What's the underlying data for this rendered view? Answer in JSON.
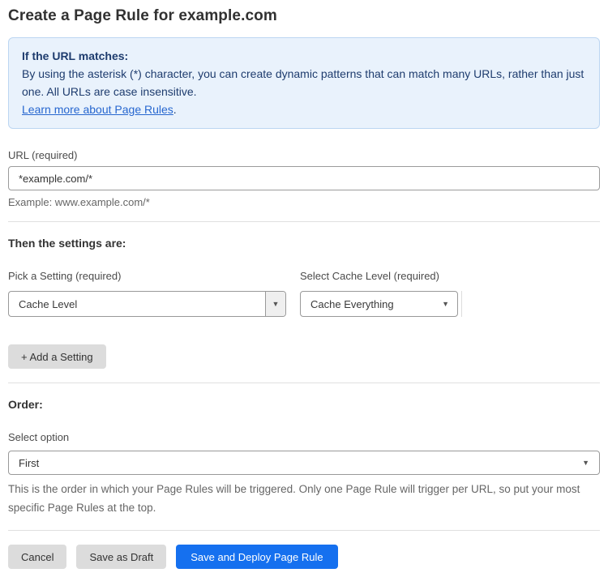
{
  "page": {
    "title": "Create a Page Rule for example.com"
  },
  "info_box": {
    "heading": "If the URL matches:",
    "body": "By using the asterisk (*) character, you can create dynamic patterns that can match many URLs, rather than just one. All URLs are case insensitive.",
    "link": "Learn more about Page Rules",
    "link_suffix": "."
  },
  "url_field": {
    "label": "URL (required)",
    "value": "*example.com/*",
    "helper": "Example: www.example.com/*"
  },
  "settings": {
    "heading": "Then the settings are:",
    "setting_label": "Pick a Setting (required)",
    "setting_value": "Cache Level",
    "cache_label": "Select Cache Level (required)",
    "cache_value": "Cache Everything",
    "add_button": "+ Add a Setting"
  },
  "order": {
    "heading": "Order:",
    "select_label": "Select option",
    "select_value": "First",
    "helper": "This is the order in which your Page Rules will be triggered. Only one Page Rule will trigger per URL, so put your most specific Page Rules at the top."
  },
  "actions": {
    "cancel": "Cancel",
    "save_draft": "Save as Draft",
    "save_deploy": "Save and Deploy Page Rule"
  },
  "icons": {
    "dropdown_arrow": "▼"
  },
  "colors": {
    "accent_blue": "#1570ef",
    "info_background": "#e9f2fc",
    "info_border": "#bcd6f2",
    "info_text": "#1e3c6e",
    "link_blue": "#2666cf",
    "button_gray": "#dcdcdc"
  }
}
